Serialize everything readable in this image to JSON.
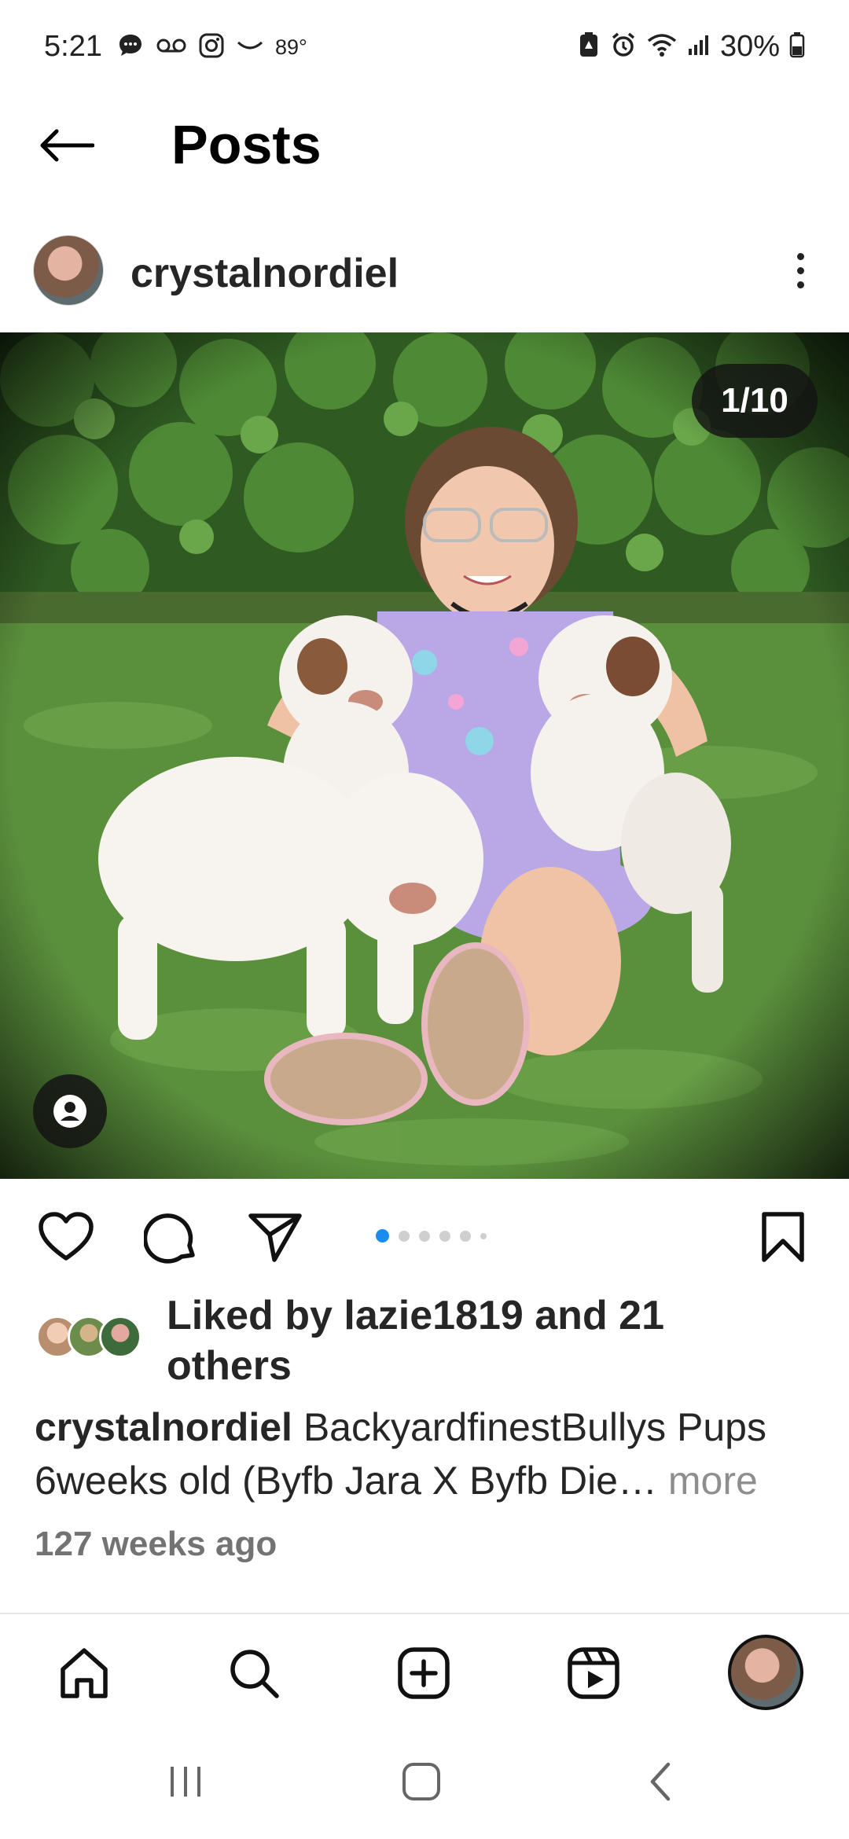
{
  "status_bar": {
    "time": "5:21",
    "temperature": "89°",
    "battery_percent": "30%",
    "left_icons": [
      "chat-bubble-icon",
      "voicemail-icon",
      "instagram-icon",
      "weather-icon"
    ],
    "right_icons": [
      "battery-saver-icon",
      "alarm-icon",
      "wifi-icon",
      "signal-icon",
      "battery-icon"
    ]
  },
  "header": {
    "title": "Posts"
  },
  "post": {
    "author": "crystalnordiel",
    "image_counter": "1/10",
    "carousel": {
      "total_dots": 6,
      "active_index": 0
    },
    "likes_text": "Liked by lazie1819 and 21 others",
    "caption_user": "crystalnordiel",
    "caption_text": "BackyardfinestBullys Pups 6weeks old (Byfb Jara X Byfb Die…",
    "caption_more": "more",
    "timestamp": "127 weeks ago"
  },
  "bottom_nav": {
    "items": [
      "home-icon",
      "search-icon",
      "create-icon",
      "reels-icon",
      "profile-avatar"
    ]
  },
  "colors": {
    "accent": "#1a8cf0",
    "text_primary": "#262626",
    "text_secondary": "#737373"
  }
}
